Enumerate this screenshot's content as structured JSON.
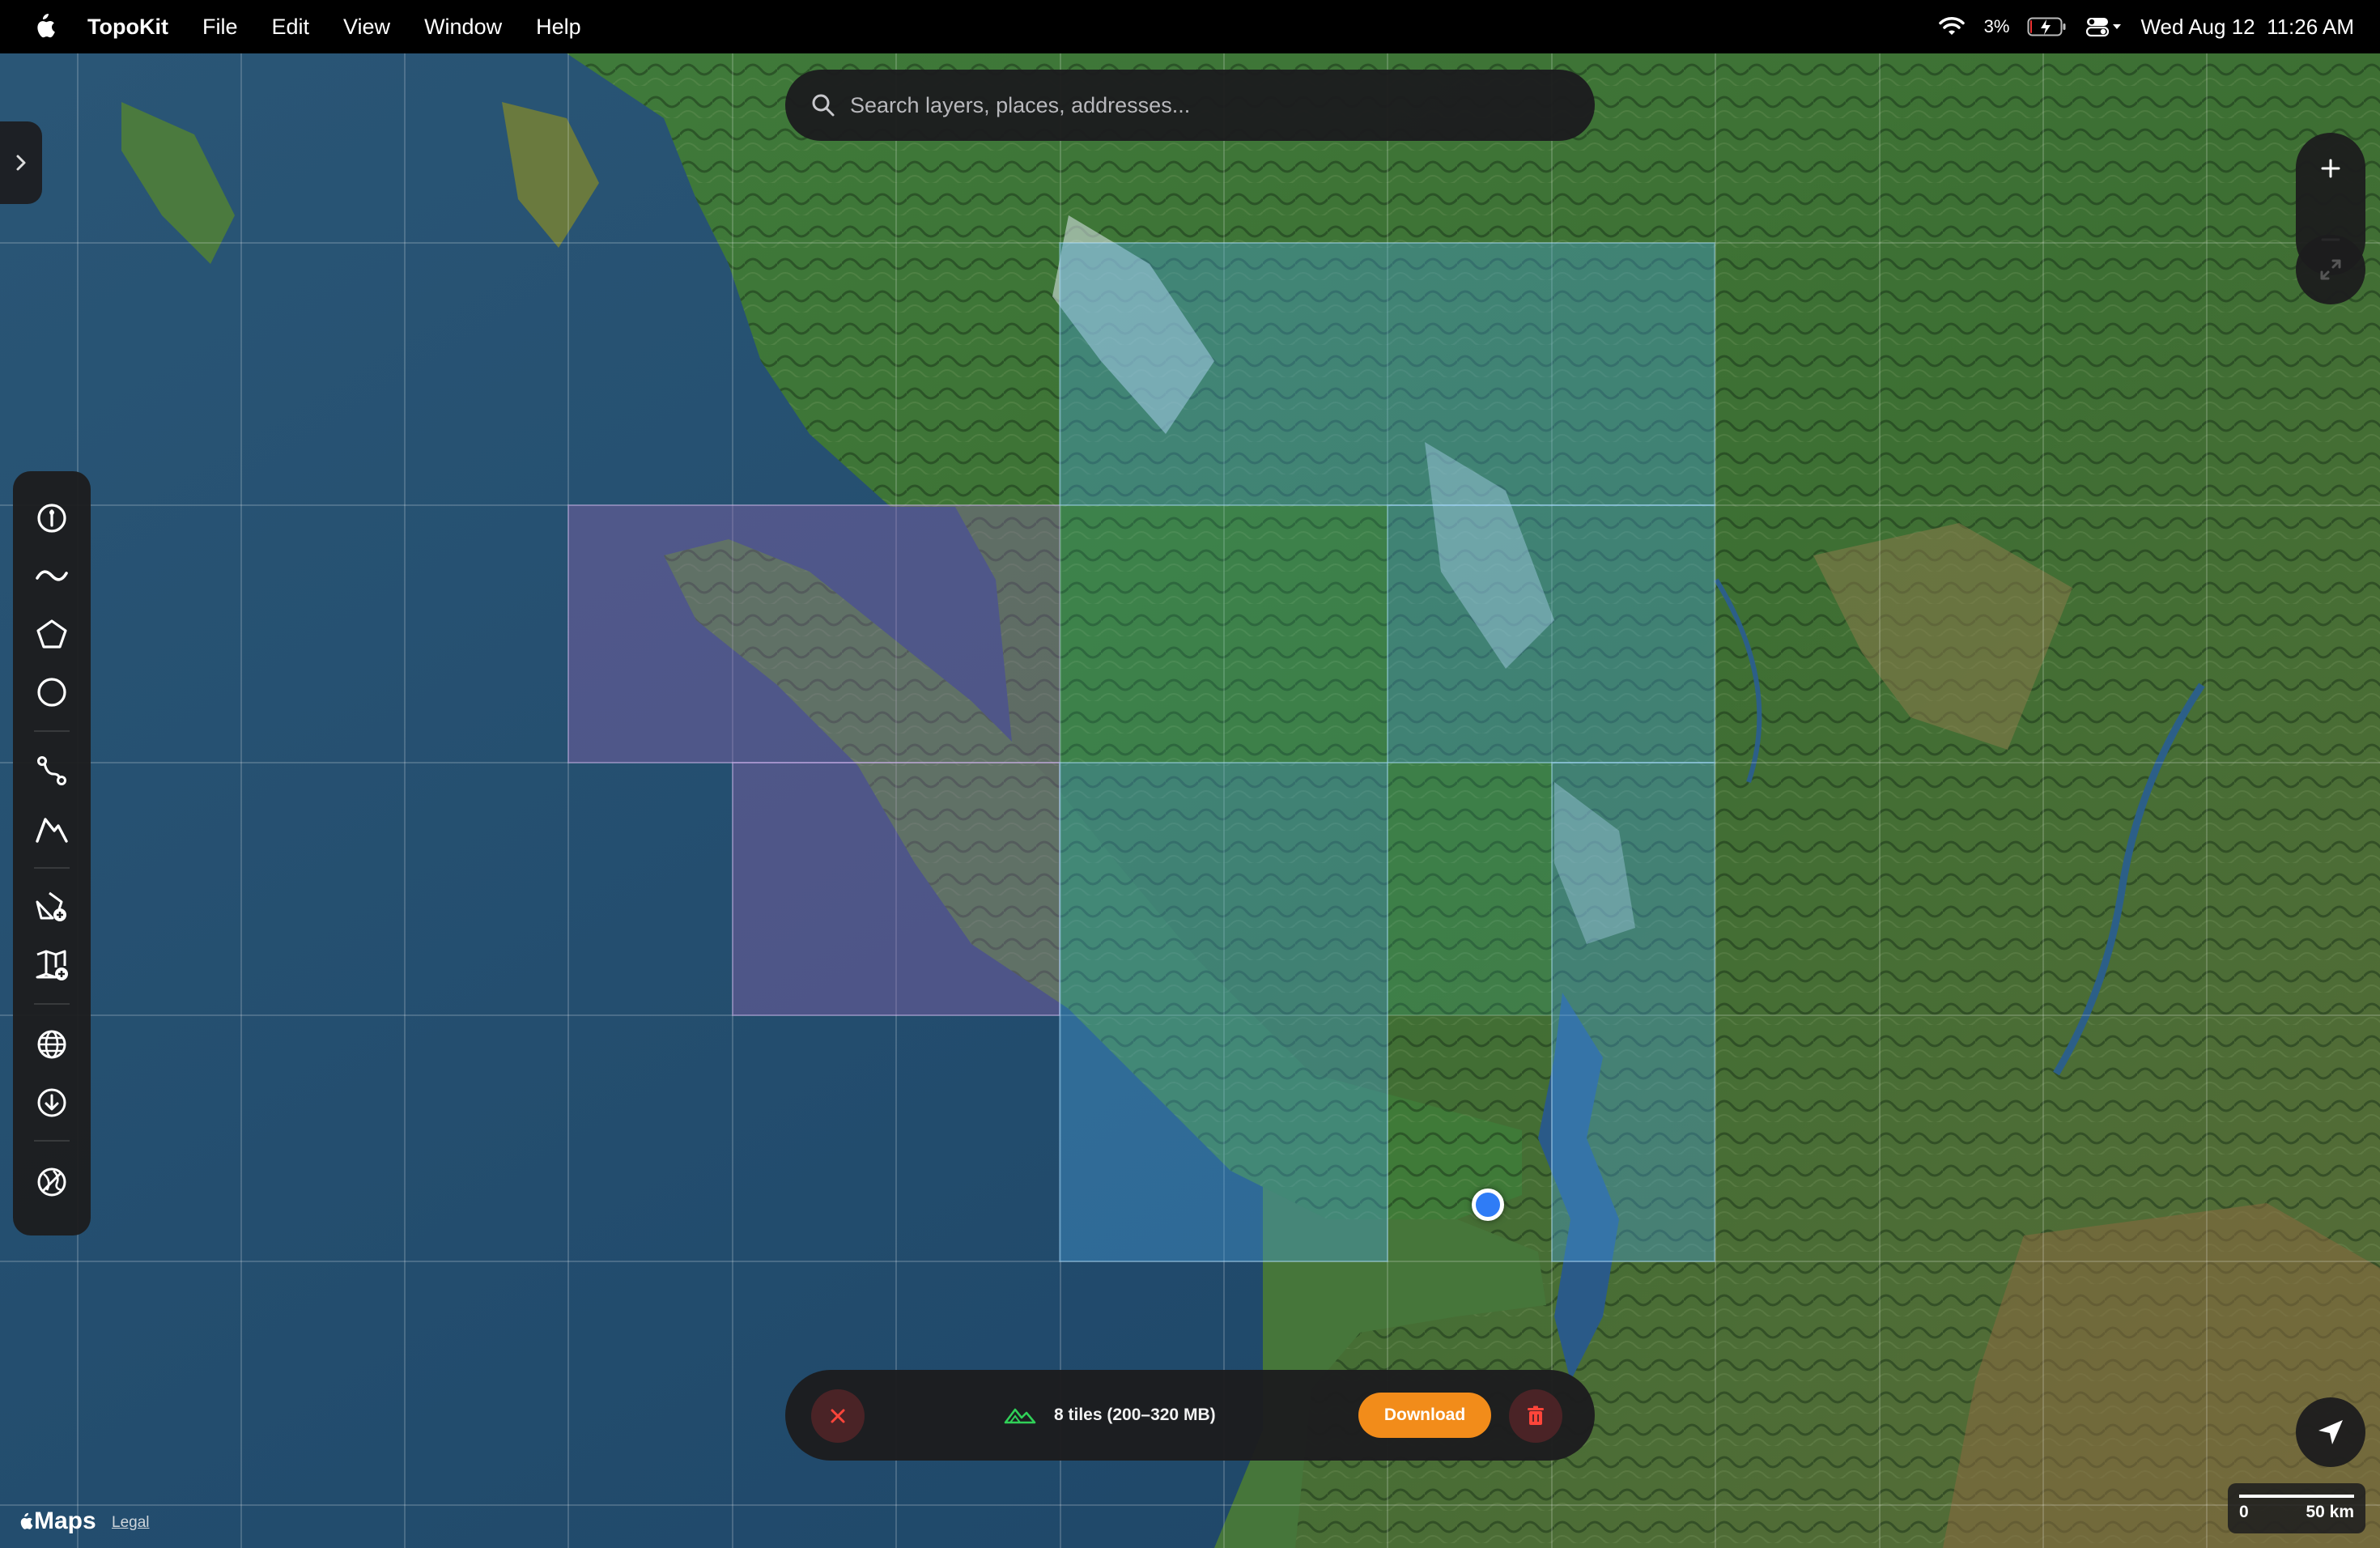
{
  "menubar": {
    "apple_icon": "apple-logo-icon",
    "app_name": "TopoKit",
    "menus": [
      "File",
      "Edit",
      "View",
      "Window",
      "Help"
    ],
    "battery_percent": "3%",
    "datetime": "Wed Aug 12  11:26 AM"
  },
  "search": {
    "placeholder": "Search layers, places, addresses..."
  },
  "tools": [
    {
      "name": "pin-icon"
    },
    {
      "name": "wave-line-icon"
    },
    {
      "name": "polygon-icon"
    },
    {
      "name": "circle-icon"
    },
    {
      "name": "route-icon"
    },
    {
      "name": "elevation-profile-icon"
    },
    {
      "name": "add-shape-icon"
    },
    {
      "name": "add-map-icon"
    },
    {
      "name": "globe-icon"
    },
    {
      "name": "download-icon"
    },
    {
      "name": "no-globe-icon"
    }
  ],
  "download_bar": {
    "tiles_label": "8 tiles (200–320 MB)",
    "download_label": "Download"
  },
  "attribution": {
    "maps": "Maps",
    "legal": "Legal"
  },
  "scale": {
    "start": "0",
    "end": "50 km"
  },
  "colors": {
    "accent_orange": "#f28c1a",
    "selection_blue": "#4fa3e0",
    "selection_purple": "#8a5fa8",
    "location_blue": "#2f7cf6"
  }
}
